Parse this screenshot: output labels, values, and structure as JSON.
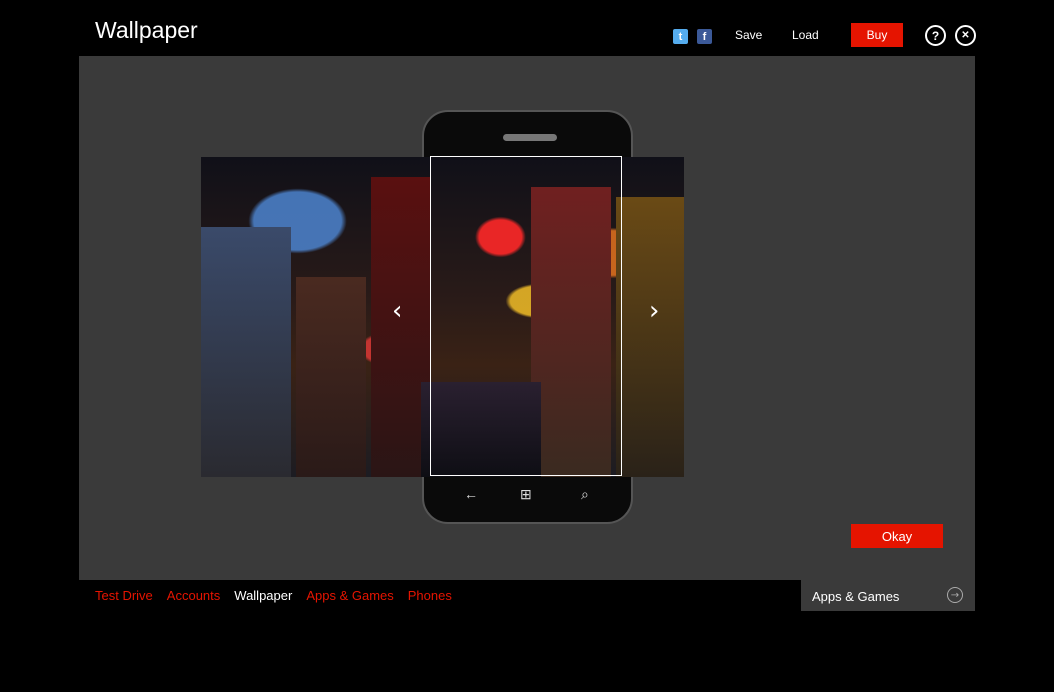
{
  "header": {
    "title": "Wallpaper",
    "twitter_icon": "twitter-icon",
    "facebook_icon": "facebook-icon",
    "twitter_glyph": "t",
    "facebook_glyph": "f",
    "save_label": "Save",
    "load_label": "Load",
    "buy_label": "Buy",
    "help_glyph": "?",
    "close_glyph": "✕"
  },
  "stage": {
    "prev_glyph": "‹",
    "next_glyph": "›",
    "phone_back_glyph": "←",
    "phone_windows_glyph": "⊞",
    "phone_search_glyph": "⌕",
    "okay_label": "Okay"
  },
  "nav": {
    "items": [
      {
        "label": "Test Drive",
        "active": false
      },
      {
        "label": "Accounts",
        "active": false
      },
      {
        "label": "Wallpaper",
        "active": true
      },
      {
        "label": "Apps & Games",
        "active": false
      },
      {
        "label": "Phones",
        "active": false
      }
    ]
  },
  "next_panel": {
    "label": "Apps & Games",
    "arrow_glyph": "→"
  },
  "colors": {
    "accent": "#e51400",
    "background": "#000000",
    "stage": "#3a3a3a"
  }
}
